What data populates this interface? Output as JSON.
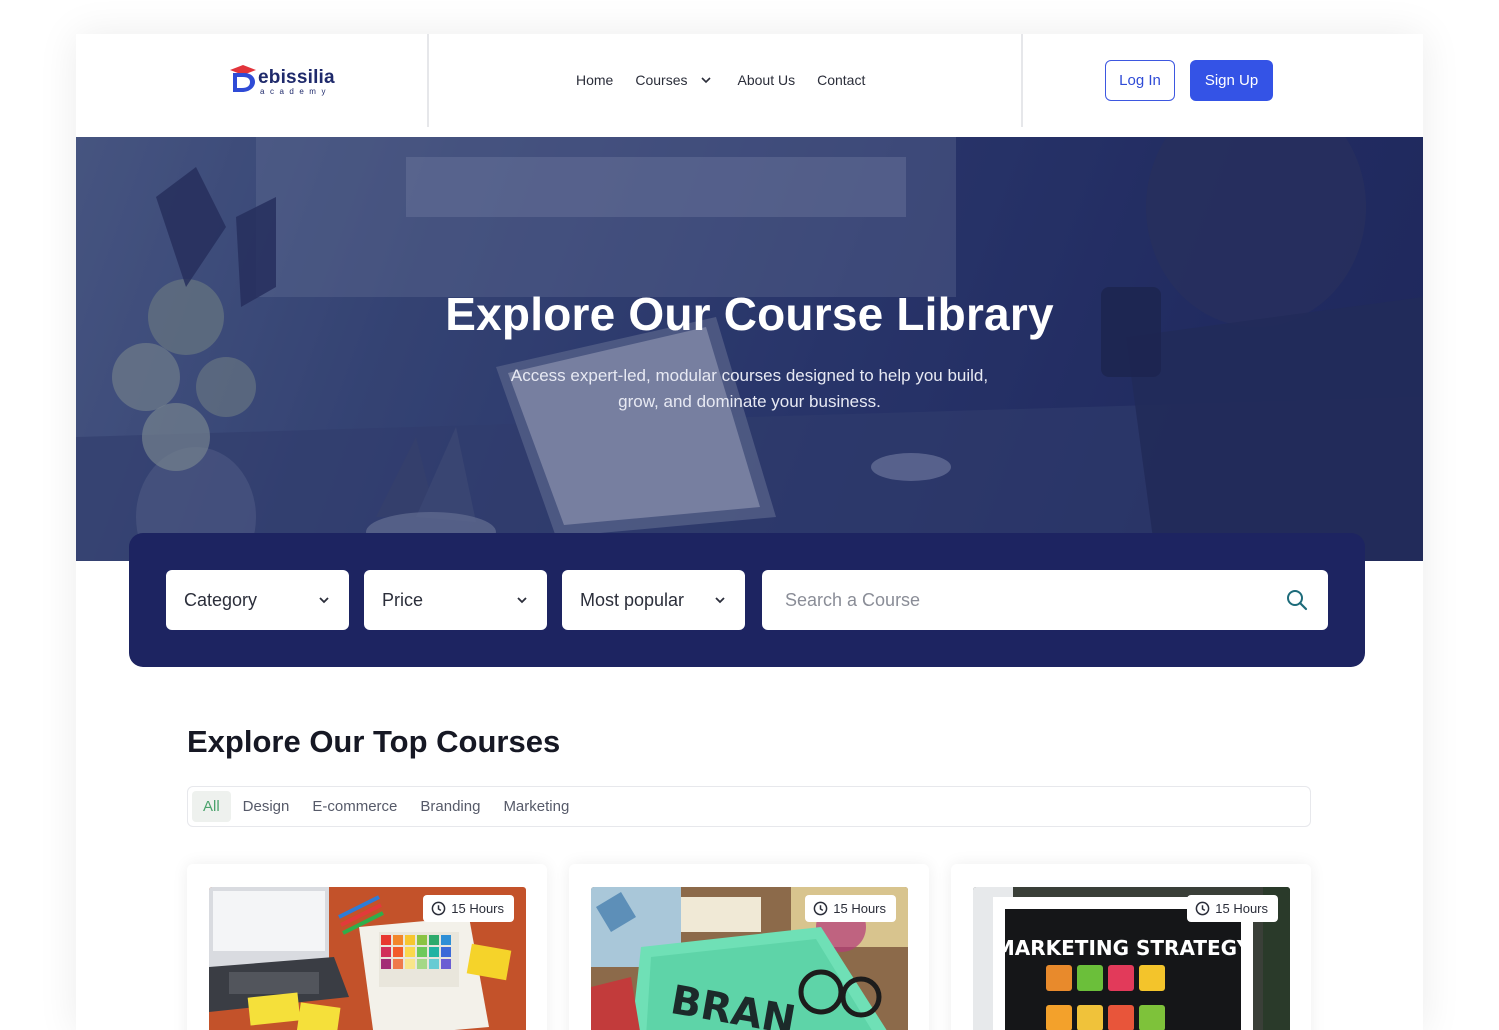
{
  "header": {
    "logo_text": "ebissilia",
    "logo_sub": "academy",
    "nav": {
      "home": "Home",
      "courses": "Courses",
      "about": "About Us",
      "contact": "Contact"
    },
    "login_label": "Log In",
    "signup_label": "Sign Up"
  },
  "hero": {
    "title": "Explore Our Course Library",
    "subtitle_line1": "Access expert-led, modular courses designed to help you build,",
    "subtitle_line2": "grow, and dominate your business."
  },
  "filters": {
    "category": "Category",
    "price": "Price",
    "sort": "Most popular",
    "search_placeholder": "Search a Course"
  },
  "section": {
    "title": "Explore Our Top Courses",
    "tabs": [
      "All",
      "Design",
      "E-commerce",
      "Branding",
      "Marketing"
    ],
    "active_tab": "All"
  },
  "courses": [
    {
      "duration": "15 Hours",
      "image": "design-workspace"
    },
    {
      "duration": "15 Hours",
      "image": "branding-desk"
    },
    {
      "duration": "15 Hours",
      "image": "marketing-strategy",
      "image_text": "MARKETING STRATEGY"
    }
  ],
  "colors": {
    "primary": "#3453e6",
    "navy": "#1d2461",
    "active_tab_text": "#4aa36c"
  }
}
